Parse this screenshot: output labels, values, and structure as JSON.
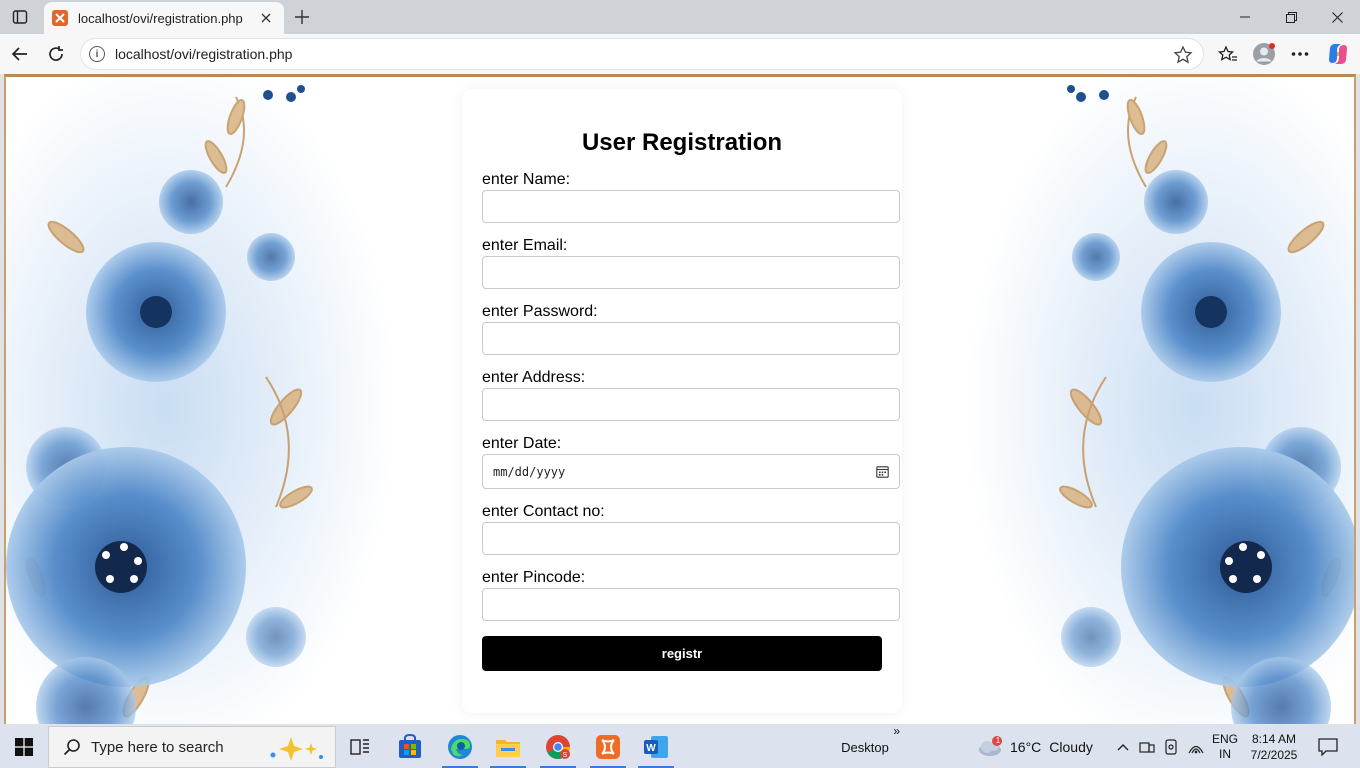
{
  "browser": {
    "tab": {
      "title": "localhost/ovi/registration.php"
    },
    "address": {
      "url": "localhost/ovi/registration.php"
    }
  },
  "form": {
    "title": "User Registration",
    "fields": [
      {
        "label": "enter Name:",
        "value": ""
      },
      {
        "label": "enter Email:",
        "value": ""
      },
      {
        "label": "enter Password:",
        "value": ""
      },
      {
        "label": "enter Address:",
        "value": ""
      },
      {
        "label": "enter Date:",
        "placeholder": "mm/dd/yyyy"
      },
      {
        "label": "enter Contact no:",
        "value": ""
      },
      {
        "label": "enter Pincode:",
        "value": ""
      }
    ],
    "submit_label": "registr"
  },
  "taskbar": {
    "search_placeholder": "Type here to search",
    "desktop_label": "Desktop",
    "weather": {
      "temp": "16°C",
      "condition": "Cloudy",
      "badge": "1"
    },
    "language": {
      "line1": "ENG",
      "line2": "IN"
    },
    "clock": {
      "time": "8:14 AM",
      "date": "7/2/2025"
    }
  },
  "colors": {
    "accent": "#3a7bd5",
    "button_bg": "#000000",
    "button_text": "#ffffff",
    "frame_brown": "#b88a55"
  },
  "icons": [
    "tab-actions-icon",
    "xampp-favicon",
    "close-icon",
    "plus-icon",
    "minimize-icon",
    "restore-icon",
    "back-arrow-icon",
    "refresh-icon",
    "info-icon",
    "star-icon",
    "favorites-icon",
    "profile-icon",
    "more-icon",
    "copilot-icon",
    "calendar-icon",
    "windows-logo-icon",
    "search-icon",
    "task-view-icon",
    "store-icon",
    "edge-icon",
    "file-explorer-icon",
    "chrome-icon",
    "xampp-icon",
    "word-icon",
    "cloud-icon",
    "chevron-up-icon",
    "network-icon",
    "notification-icon"
  ]
}
